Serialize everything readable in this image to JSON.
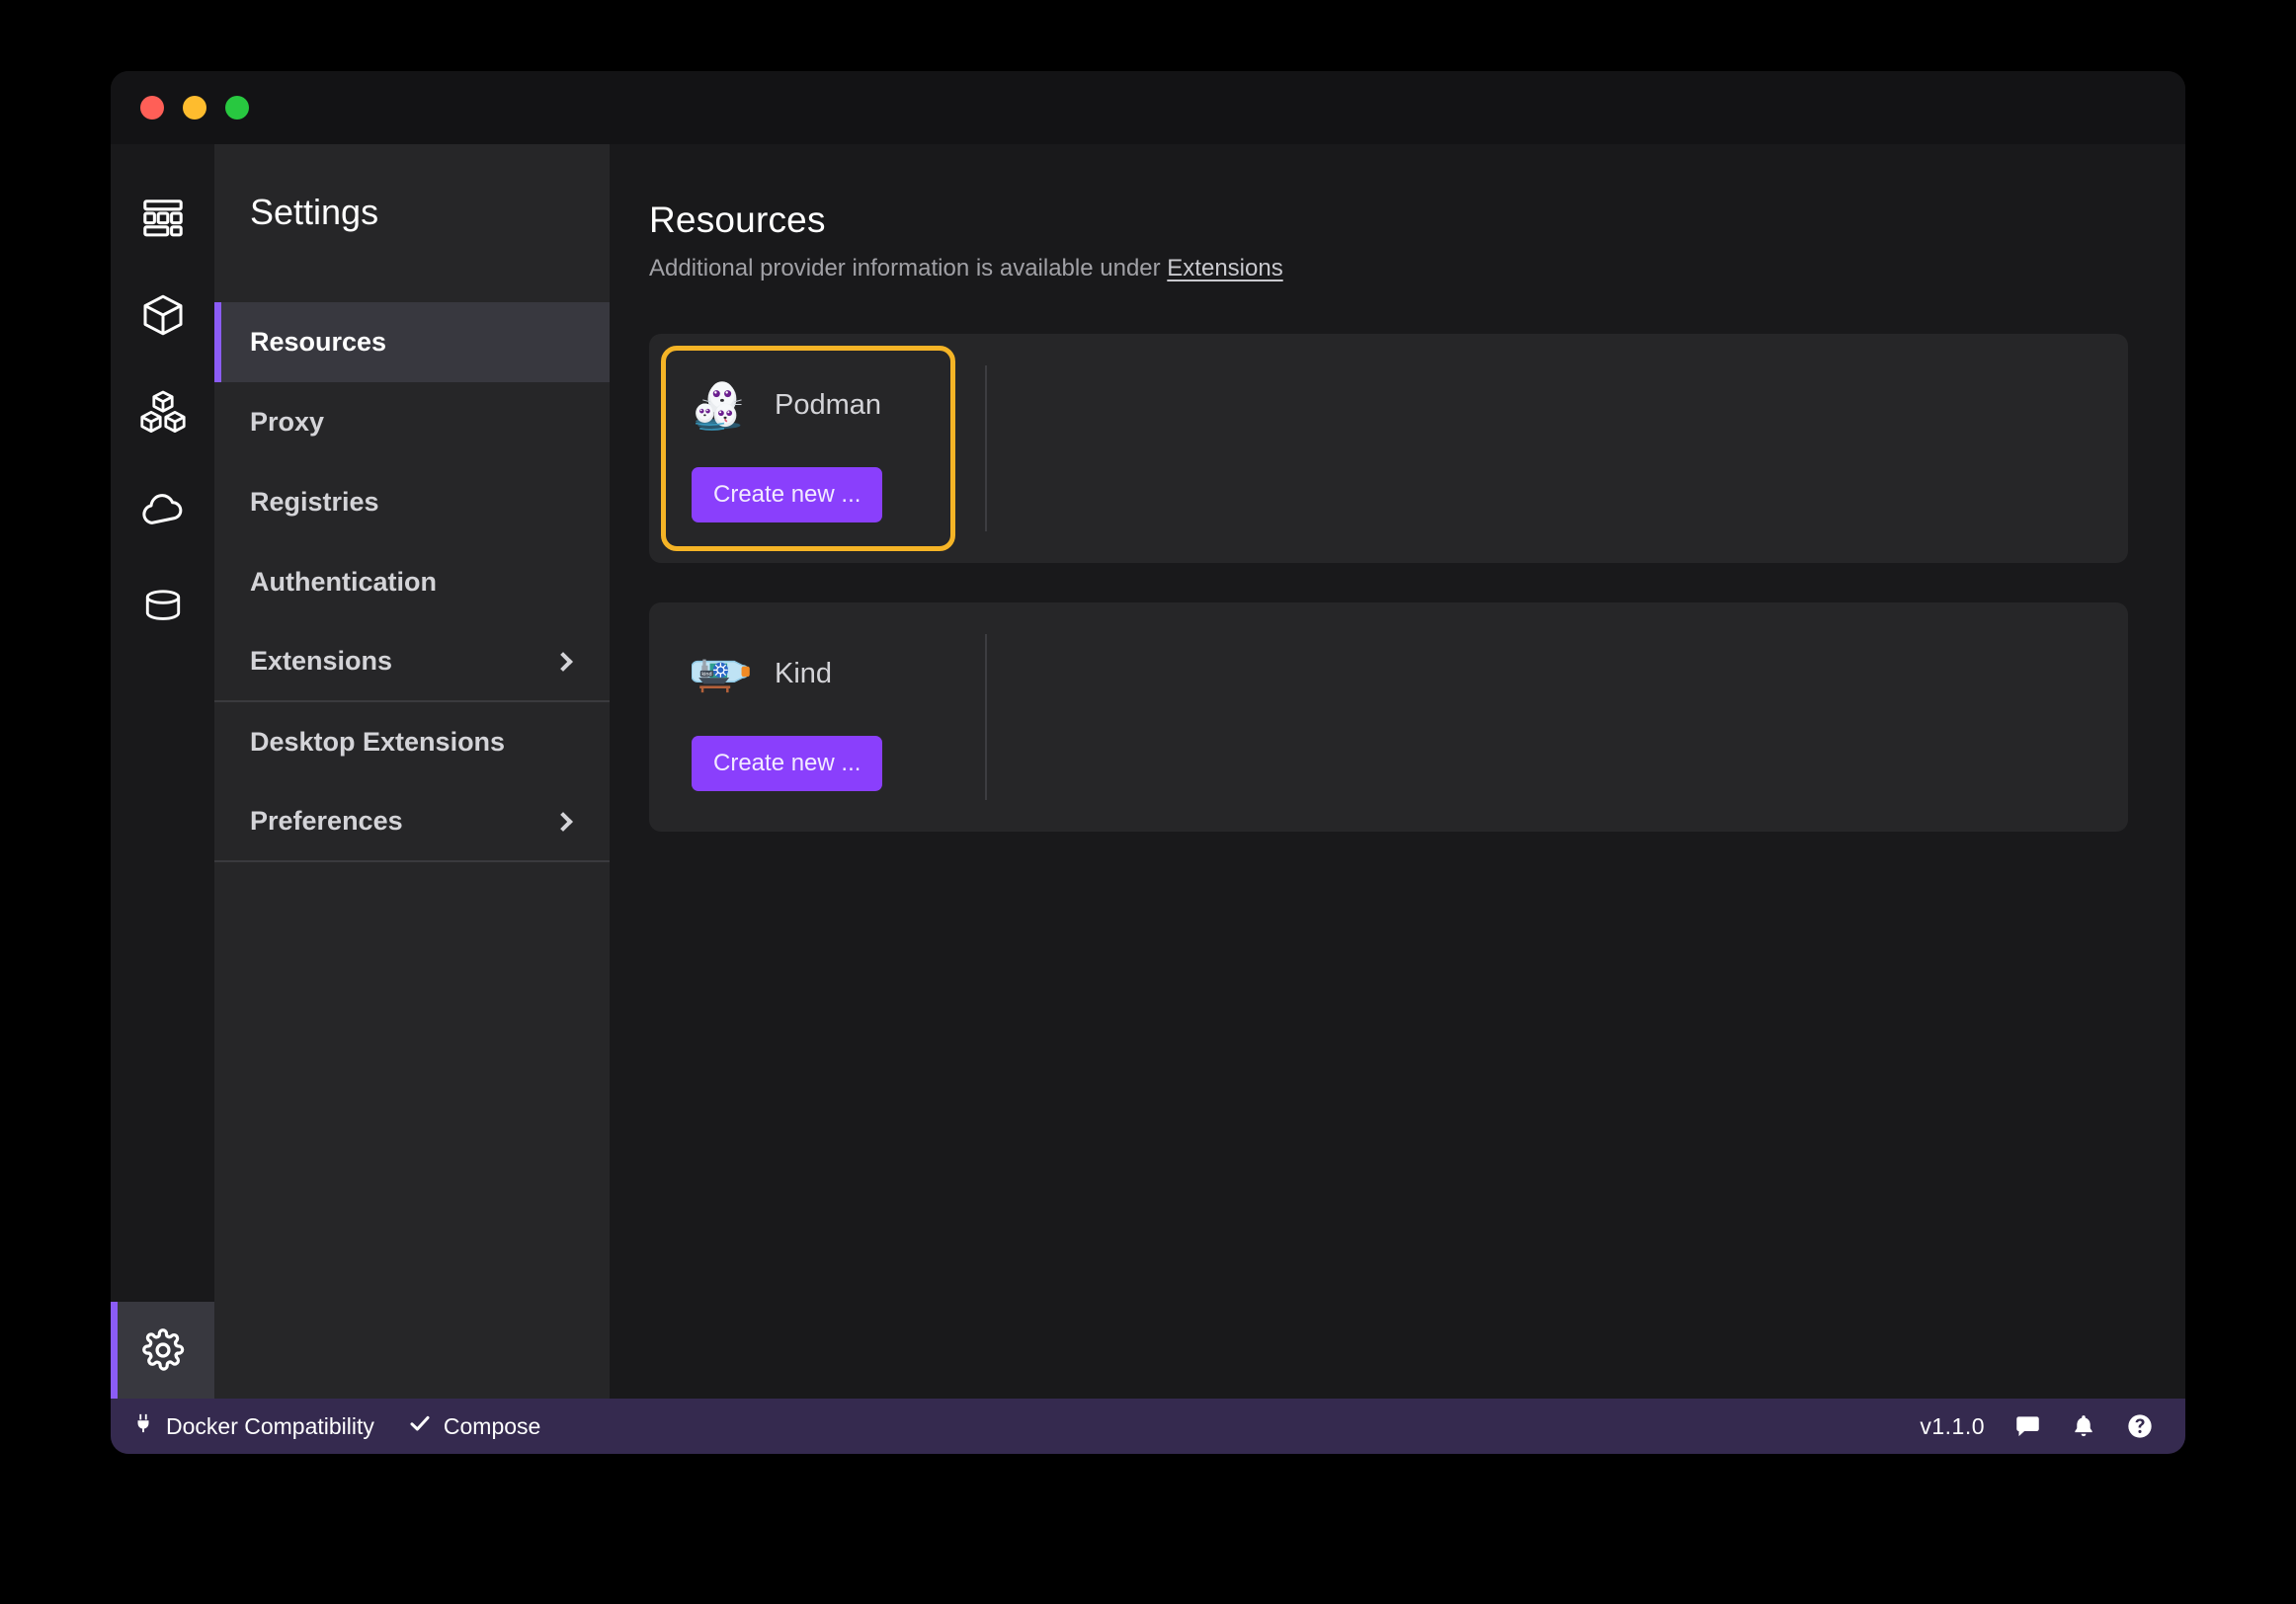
{
  "window": {
    "traffic_lights": [
      "close",
      "minimize",
      "maximize"
    ]
  },
  "nav_rail": {
    "items": [
      {
        "id": "dashboard",
        "icon": "dashboard-icon",
        "active": false
      },
      {
        "id": "containers",
        "icon": "cube-icon",
        "active": false
      },
      {
        "id": "pods",
        "icon": "cubes-icon",
        "active": false
      },
      {
        "id": "images",
        "icon": "cloud-icon",
        "active": false
      },
      {
        "id": "volumes",
        "icon": "database-icon",
        "active": false
      },
      {
        "id": "settings",
        "icon": "gear-icon",
        "active": true
      }
    ]
  },
  "settings": {
    "title": "Settings",
    "items": [
      {
        "label": "Resources",
        "selected": true,
        "chevron": false
      },
      {
        "label": "Proxy",
        "selected": false,
        "chevron": false
      },
      {
        "label": "Registries",
        "selected": false,
        "chevron": false
      },
      {
        "label": "Authentication",
        "selected": false,
        "chevron": false
      },
      {
        "label": "Extensions",
        "selected": false,
        "chevron": true
      },
      {
        "label": "Desktop Extensions",
        "selected": false,
        "chevron": false
      },
      {
        "label": "Preferences",
        "selected": false,
        "chevron": true
      }
    ]
  },
  "main": {
    "title": "Resources",
    "subtitle_prefix": "Additional provider information is available under ",
    "subtitle_link": "Extensions",
    "providers": [
      {
        "name": "Podman",
        "logo": "podman-seal-logo",
        "create_label": "Create new ...",
        "focused": true
      },
      {
        "name": "Kind",
        "logo": "kind-ship-in-bottle-logo",
        "create_label": "Create new ...",
        "focused": false
      }
    ]
  },
  "statusbar": {
    "docker_compat_label": "Docker Compatibility",
    "compose_label": "Compose",
    "version": "v1.1.0",
    "icons": [
      "chat-bubble-icon",
      "bell-icon",
      "help-circle-icon"
    ]
  },
  "colors": {
    "accent_purple": "#8b5cf6",
    "button_purple": "#8a3ffc",
    "focus_outline": "#f5b426",
    "statusbar_bg": "#352a4f",
    "window_bg": "#19191b",
    "panel_bg": "#262628",
    "selected_row_bg": "#38383f"
  }
}
